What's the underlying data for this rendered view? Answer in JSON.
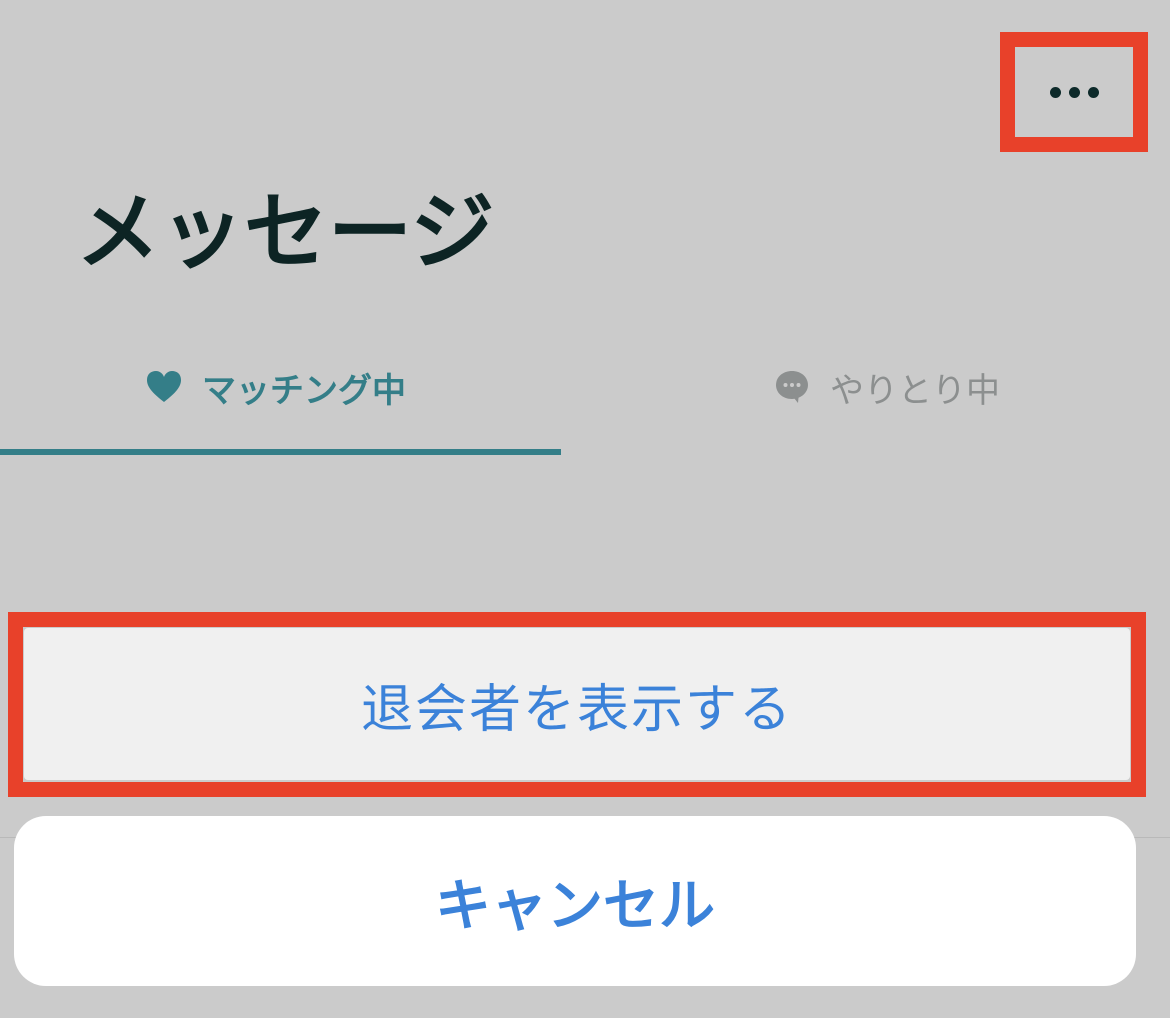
{
  "header": {
    "more_icon": "ellipsis-icon",
    "title": "メッセージ"
  },
  "tabs": [
    {
      "label": "マッチング中",
      "icon": "heart-icon",
      "active": true
    },
    {
      "label": "やりとり中",
      "icon": "speech-bubble-icon",
      "active": false
    }
  ],
  "action_sheet": {
    "option_label": "退会者を表示する",
    "cancel_label": "キャンセル"
  },
  "colors": {
    "accent": "#347e88",
    "action_blue": "#3b82d9",
    "highlight_red": "#e8412a",
    "title_color": "#0d2424",
    "inactive_tab": "#8c8f8f",
    "dim_background": "#cbcbcb"
  }
}
